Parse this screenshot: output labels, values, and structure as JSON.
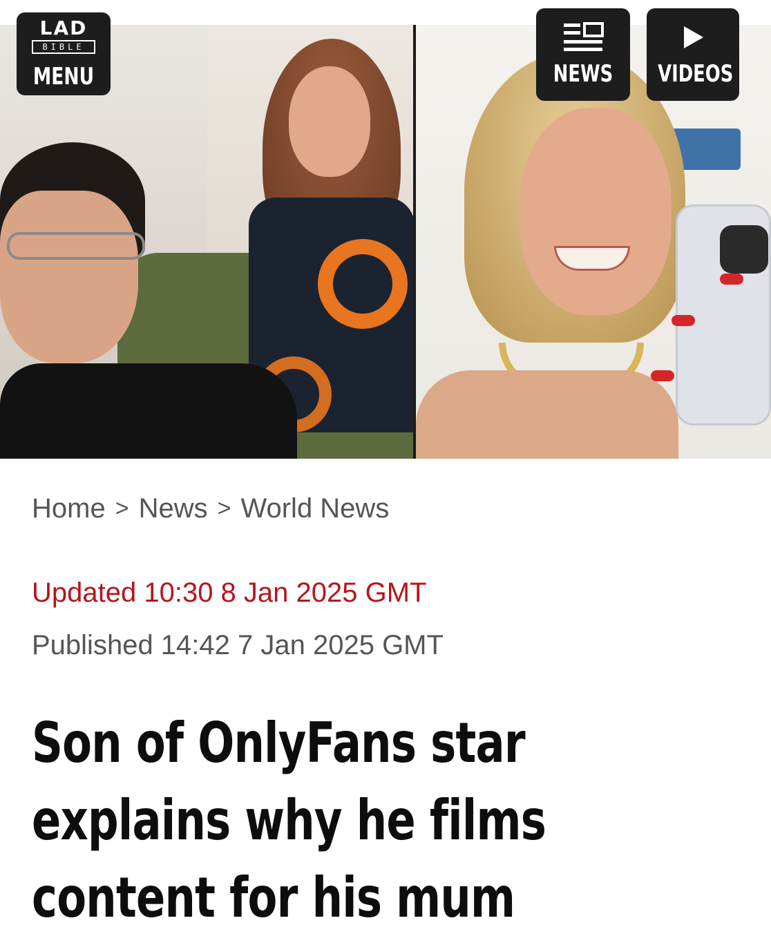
{
  "header": {
    "menu": {
      "logo_top": "LAD",
      "logo_bottom": "BIBLE",
      "label": "MENU",
      "icon": "ladbible-logo"
    },
    "news": {
      "label": "NEWS",
      "icon": "news-icon"
    },
    "videos": {
      "label": "VIDEOS",
      "icon": "play-icon"
    }
  },
  "hero": {
    "left_panel": "photo",
    "right_panel": "photo"
  },
  "breadcrumb": {
    "items": [
      {
        "label": "Home"
      },
      {
        "label": "News"
      },
      {
        "label": "World News"
      }
    ],
    "separator": ">"
  },
  "meta": {
    "updated": "Updated 10:30 8 Jan 2025 GMT",
    "published": "Published 14:42 7 Jan 2025 GMT"
  },
  "article": {
    "headline": "Son of OnlyFans star explains why he films content for his mum"
  },
  "colors": {
    "updated_text": "#b5151b",
    "meta_text": "#555555",
    "button_bg": "#1d1d1d",
    "headline_text": "#0d0d0d"
  }
}
